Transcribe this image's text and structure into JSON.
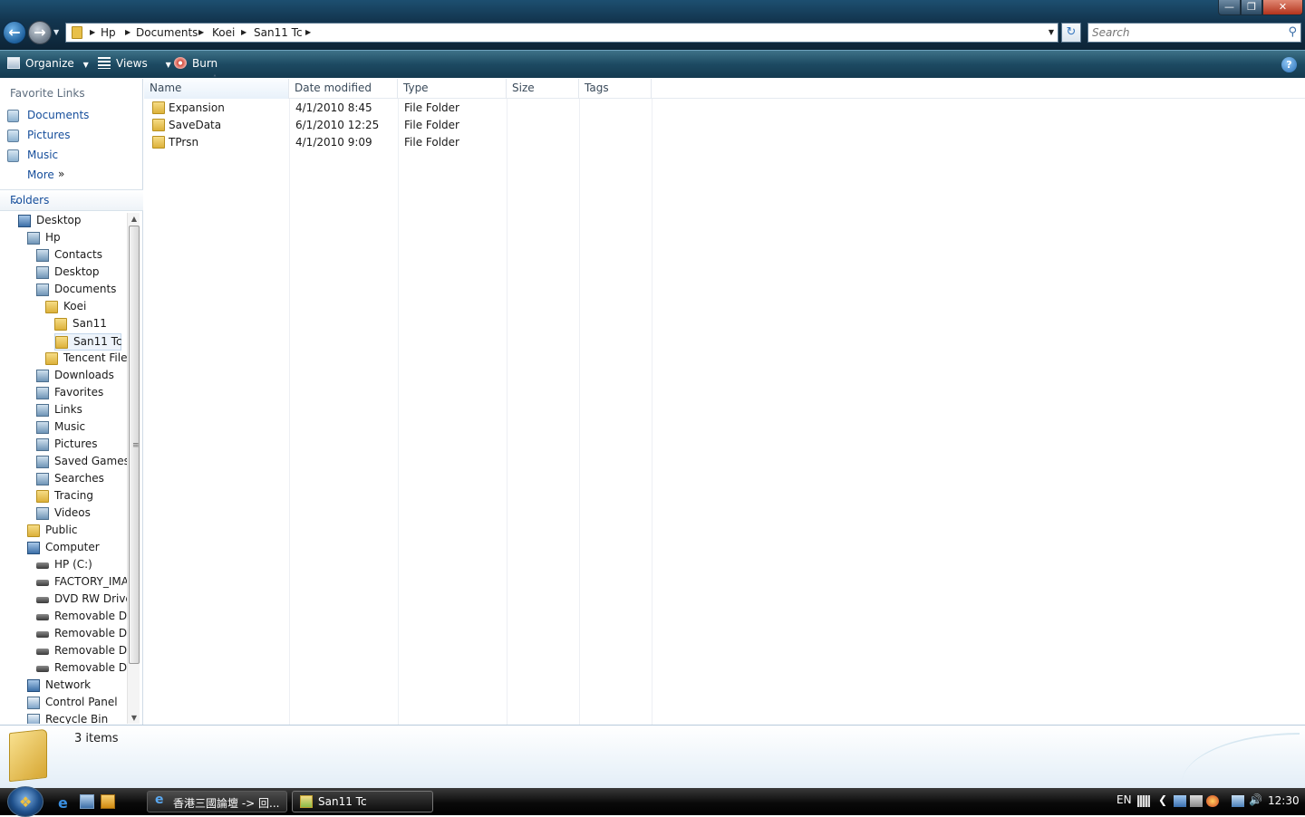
{
  "address": {
    "crumbs": [
      "Hp",
      "Documents",
      "Koei",
      "San11 Tc"
    ]
  },
  "search": {
    "placeholder": "Search"
  },
  "toolbar": {
    "organize_label": "Organize",
    "views_label": "Views",
    "burn_label": "Burn"
  },
  "navpane": {
    "favorites_title": "Favorite Links",
    "favorites": [
      "Documents",
      "Pictures",
      "Music"
    ],
    "more_label": "More",
    "folders_label": "Folders"
  },
  "tree": [
    {
      "label": "Desktop",
      "icon": "desktop-icon"
    },
    {
      "label": "Hp",
      "icon": "user-folder-icon"
    },
    {
      "label": "Contacts",
      "icon": "contacts-icon"
    },
    {
      "label": "Desktop",
      "icon": "desktop-folder-icon"
    },
    {
      "label": "Documents",
      "icon": "documents-icon"
    },
    {
      "label": "Koei",
      "icon": "folder-icon"
    },
    {
      "label": "San11",
      "icon": "folder-icon"
    },
    {
      "label": "San11 Tc",
      "icon": "folder-icon",
      "selected": true
    },
    {
      "label": "Tencent Files",
      "icon": "folder-icon"
    },
    {
      "label": "Downloads",
      "icon": "downloads-icon"
    },
    {
      "label": "Favorites",
      "icon": "favorites-icon"
    },
    {
      "label": "Links",
      "icon": "links-icon"
    },
    {
      "label": "Music",
      "icon": "music-icon"
    },
    {
      "label": "Pictures",
      "icon": "pictures-icon"
    },
    {
      "label": "Saved Games",
      "icon": "saved-games-icon"
    },
    {
      "label": "Searches",
      "icon": "searches-icon"
    },
    {
      "label": "Tracing",
      "icon": "folder-icon"
    },
    {
      "label": "Videos",
      "icon": "videos-icon"
    },
    {
      "label": "Public",
      "icon": "folder-icon"
    },
    {
      "label": "Computer",
      "icon": "computer-icon"
    },
    {
      "label": "HP (C:)",
      "icon": "hard-drive-icon"
    },
    {
      "label": "FACTORY_IMA",
      "icon": "drive-icon"
    },
    {
      "label": "DVD RW Drive",
      "icon": "dvd-drive-icon"
    },
    {
      "label": "Removable Dis",
      "icon": "removable-disk-icon"
    },
    {
      "label": "Removable Dis",
      "icon": "removable-disk-icon"
    },
    {
      "label": "Removable Dis",
      "icon": "removable-disk-icon"
    },
    {
      "label": "Removable Dis",
      "icon": "removable-disk-icon"
    },
    {
      "label": "Network",
      "icon": "network-icon"
    },
    {
      "label": "Control Panel",
      "icon": "control-panel-icon"
    },
    {
      "label": "Recycle Bin",
      "icon": "recycle-bin-icon"
    }
  ],
  "columns": [
    "Name",
    "Date modified",
    "Type",
    "Size",
    "Tags"
  ],
  "files": [
    {
      "name": "Expansion",
      "date": "4/1/2010 8:45",
      "type": "File Folder",
      "size": "",
      "tags": ""
    },
    {
      "name": "SaveData",
      "date": "6/1/2010 12:25",
      "type": "File Folder",
      "size": "",
      "tags": ""
    },
    {
      "name": "TPrsn",
      "date": "4/1/2010 9:09",
      "type": "File Folder",
      "size": "",
      "tags": ""
    }
  ],
  "details": {
    "count": "3 items"
  },
  "taskbar": {
    "tasks": [
      {
        "label": "香港三國論壇 -> 回...",
        "icon": "ie-icon"
      },
      {
        "label": "San11 Tc",
        "icon": "explorer-icon"
      }
    ],
    "lang": "EN",
    "clock": "12:30"
  },
  "colors": {
    "accent": "#1d4a62",
    "link": "#164e9b",
    "folder": "#e8c04a"
  }
}
